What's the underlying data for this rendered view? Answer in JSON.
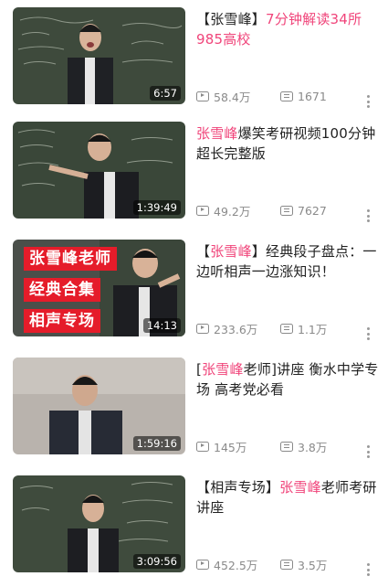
{
  "colors": {
    "highlight": "#f0447a",
    "meta": "#8a8a8a",
    "tag_red": "#e51c2a"
  },
  "icons": {
    "views": "play-count-icon",
    "danmaku": "danmaku-count-icon",
    "more": "more-vertical-icon"
  },
  "videos": [
    {
      "title_pre": "【张雪峰】",
      "title_hl": "7分钟解读34所985高校",
      "title_post": "",
      "duration": "6:57",
      "views": "58.4万",
      "danmaku": "1671"
    },
    {
      "title_pre": "",
      "title_hl": "张雪峰",
      "title_post": "爆笑考研视频100分钟超长完整版",
      "duration": "1:39:49",
      "views": "49.2万",
      "danmaku": "7627"
    },
    {
      "title_pre": "【",
      "title_hl": "张雪峰",
      "title_post": "】经典段子盘点：一边听相声一边涨知识！",
      "duration": "14:13",
      "views": "233.6万",
      "danmaku": "1.1万",
      "thumb_tags": [
        "张雪峰老师",
        "经典合集",
        "相声专场"
      ]
    },
    {
      "title_pre": "[",
      "title_hl": "张雪峰",
      "title_post": "老师]讲座 衡水中学专场 高考党必看",
      "duration": "1:59:16",
      "views": "145万",
      "danmaku": "3.8万"
    },
    {
      "title_pre": "【相声专场】",
      "title_hl": "张雪峰",
      "title_post": "老师考研讲座",
      "duration": "3:09:56",
      "views": "452.5万",
      "danmaku": "3.5万"
    }
  ]
}
